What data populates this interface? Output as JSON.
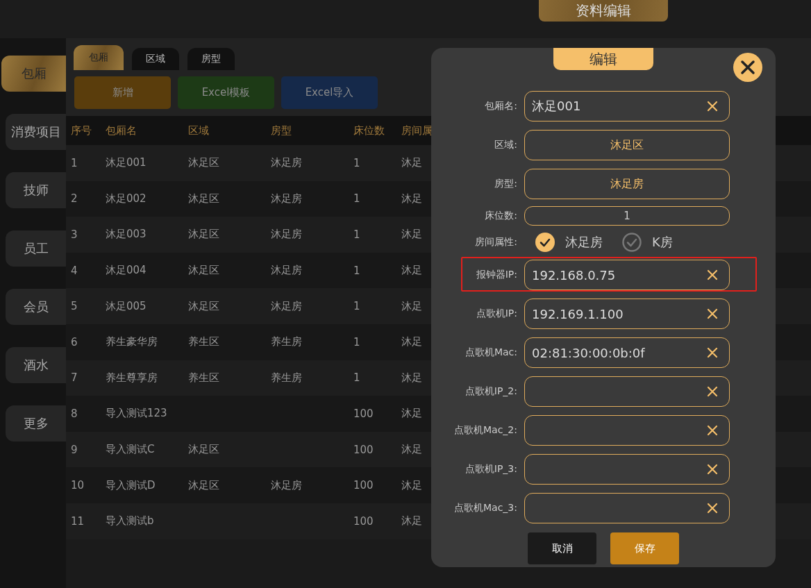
{
  "header": {
    "title": "资料编辑"
  },
  "sidebar": {
    "items": [
      {
        "label": "包厢",
        "selected": true
      },
      {
        "label": "消费项目",
        "selected": false
      },
      {
        "label": "技师",
        "selected": false
      },
      {
        "label": "员工",
        "selected": false
      },
      {
        "label": "会员",
        "selected": false
      },
      {
        "label": "酒水",
        "selected": false
      },
      {
        "label": "更多",
        "selected": false
      }
    ]
  },
  "tabs": [
    {
      "label": "包厢",
      "selected": true
    },
    {
      "label": "区域",
      "selected": false
    },
    {
      "label": "房型",
      "selected": false
    }
  ],
  "actions": [
    {
      "label": "新增",
      "color": "#5a3d0c"
    },
    {
      "label": "Excel模板",
      "color": "#1d3a16"
    },
    {
      "label": "Excel导入",
      "color": "#15294a"
    }
  ],
  "table": {
    "columns": [
      "序号",
      "包厢名",
      "区域",
      "房型",
      "床位数",
      "房间属"
    ],
    "rows": [
      [
        "1",
        "沐足001",
        "沐足区",
        "沐足房",
        "1",
        "沐足"
      ],
      [
        "2",
        "沐足002",
        "沐足区",
        "沐足房",
        "1",
        "沐足"
      ],
      [
        "3",
        "沐足003",
        "沐足区",
        "沐足房",
        "1",
        "沐足"
      ],
      [
        "4",
        "沐足004",
        "沐足区",
        "沐足房",
        "1",
        "沐足"
      ],
      [
        "5",
        "沐足005",
        "沐足区",
        "沐足房",
        "1",
        "沐足"
      ],
      [
        "6",
        "养生豪华房",
        "养生区",
        "养生房",
        "1",
        "沐足"
      ],
      [
        "7",
        "养生尊享房",
        "养生区",
        "养生房",
        "1",
        "沐足"
      ],
      [
        "8",
        "导入测试123",
        "",
        "",
        "100",
        "沐足"
      ],
      [
        "9",
        "导入测试C",
        "沐足区",
        "",
        "100",
        "沐足"
      ],
      [
        "10",
        "导入测试D",
        "沐足区",
        "沐足房",
        "100",
        "沐足"
      ],
      [
        "11",
        "导入测试b",
        "",
        "",
        "100",
        "沐足"
      ]
    ]
  },
  "dialog": {
    "title": "编辑",
    "fields": [
      {
        "kind": "text",
        "label": "包厢名:",
        "value": "沐足001",
        "highlighted": false
      },
      {
        "kind": "select",
        "label": "区域:",
        "value": "沐足区",
        "highlighted": false
      },
      {
        "kind": "select",
        "label": "房型:",
        "value": "沐足房",
        "highlighted": false
      },
      {
        "kind": "number",
        "label": "床位数:",
        "value": "1",
        "highlighted": false
      },
      {
        "kind": "checks",
        "label": "房间属性:",
        "options": [
          {
            "label": "沐足房",
            "checked": true
          },
          {
            "label": "K房",
            "checked": false
          }
        ],
        "highlighted": false
      },
      {
        "kind": "text",
        "label": "报钟器IP:",
        "value": "192.168.0.75",
        "highlighted": true
      },
      {
        "kind": "text",
        "label": "点歌机IP:",
        "value": "192.169.1.100",
        "highlighted": false
      },
      {
        "kind": "text",
        "label": "点歌机Mac:",
        "value": "02:81:30:00:0b:0f",
        "highlighted": false
      },
      {
        "kind": "text",
        "label": "点歌机IP_2:",
        "highlighted": false
      },
      {
        "kind": "text",
        "label": "点歌机Mac_2:",
        "highlighted": false
      },
      {
        "kind": "text",
        "label": "点歌机IP_3:",
        "highlighted": false
      },
      {
        "kind": "text",
        "label": "点歌机Mac_3:",
        "highlighted": false
      }
    ],
    "buttons": [
      {
        "label": "取消",
        "kind": "cancel"
      },
      {
        "label": "保存",
        "kind": "primary"
      }
    ]
  }
}
